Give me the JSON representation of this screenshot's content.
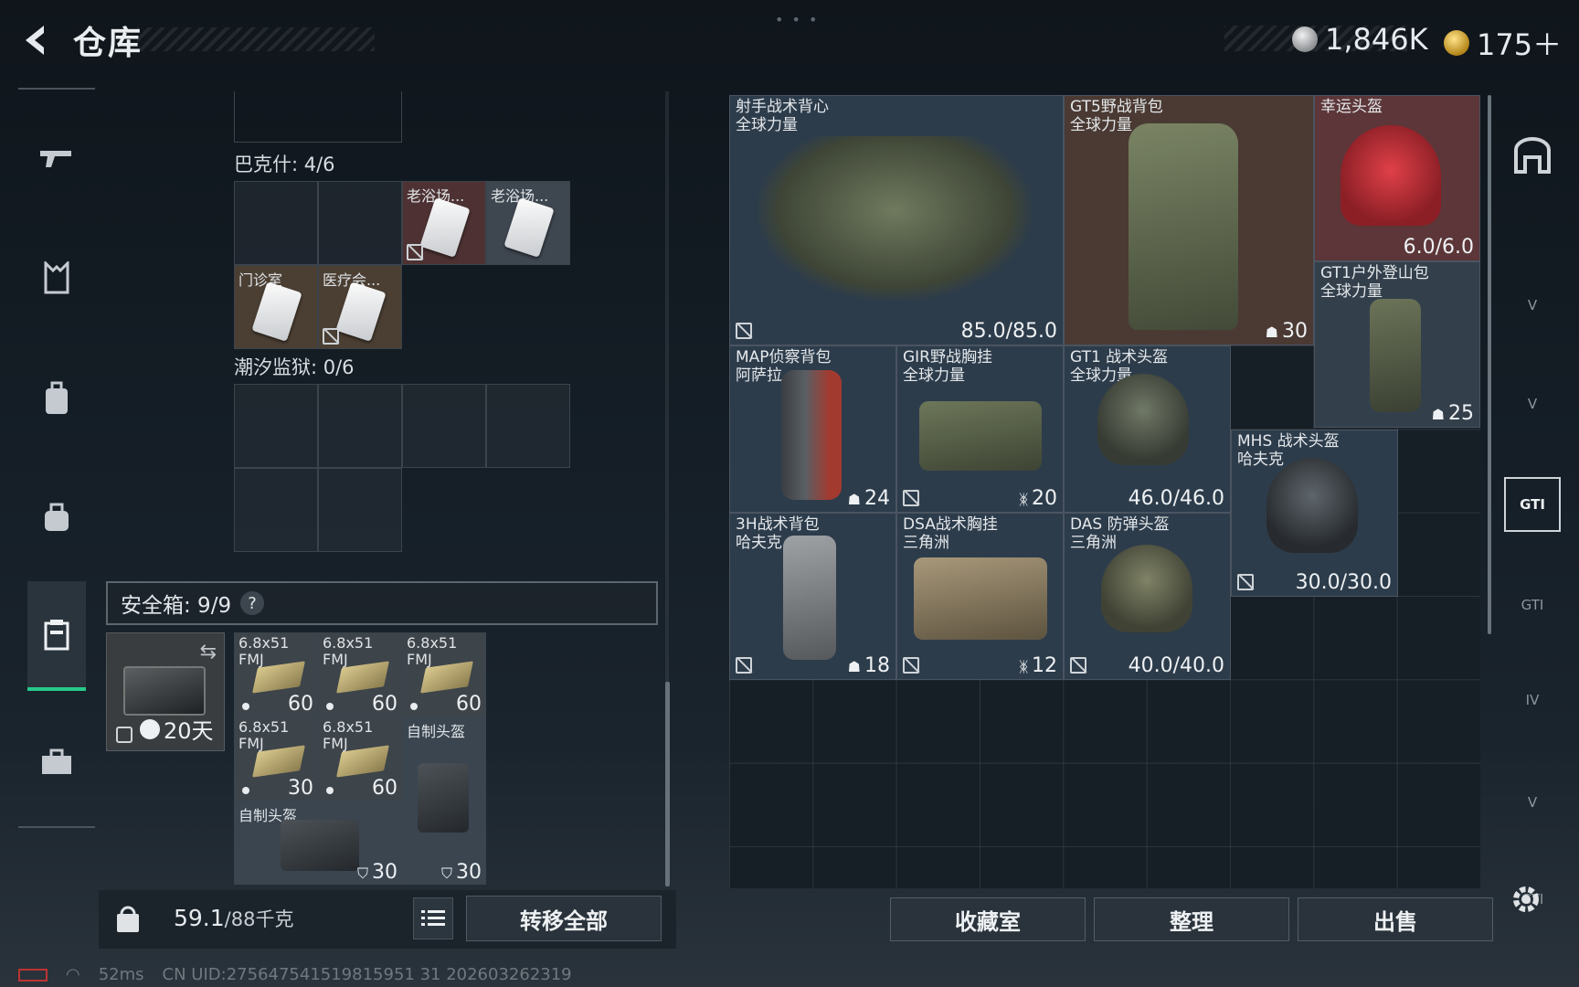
{
  "header": {
    "title": "仓库",
    "currency_silver": "1,846K",
    "currency_gold": "175＋"
  },
  "left_nav": [
    "weapon-icon",
    "vest-icon",
    "backpack-icon",
    "bag-icon",
    "safebox-icon",
    "toolbox-icon"
  ],
  "stash": {
    "section_bakshi": "巴克什: 4/6",
    "section_tidal": "潮汐监狱: 0/6",
    "keycards": [
      {
        "name": "老浴场..."
      },
      {
        "name": "老浴场..."
      },
      {
        "name": "门诊室"
      },
      {
        "name": "医疗会..."
      }
    ]
  },
  "safebox": {
    "header": "安全箱: 9/9",
    "help": "?",
    "timer": "20天",
    "items": [
      {
        "name": "6.8x51\nFMJ",
        "count": "60"
      },
      {
        "name": "6.8x51\nFMJ",
        "count": "60"
      },
      {
        "name": "6.8x51\nFMJ",
        "count": "60"
      },
      {
        "name": "6.8x51\nFMJ",
        "count": "30"
      },
      {
        "name": "6.8x51\nFMJ",
        "count": "60"
      },
      {
        "name": "自制头盔",
        "count": "30"
      },
      {
        "name": "自制头盔",
        "count": "30"
      }
    ]
  },
  "bottom_left": {
    "weight_value": "59.1",
    "weight_max": "/88千克",
    "transfer_all": "转移全部"
  },
  "stash_items": [
    {
      "name": "射手战术背心\n全球力量",
      "value": "85.0/85.0"
    },
    {
      "name": "GT5野战背包\n全球力量",
      "value": "30"
    },
    {
      "name": "幸运头盔",
      "value": "6.0/6.0"
    },
    {
      "name": "GT1户外登山包\n全球力量",
      "value": "25"
    },
    {
      "name": "MAP侦察背包\n阿萨拉",
      "value": "24"
    },
    {
      "name": "GIR野战胸挂\n全球力量",
      "value": "20"
    },
    {
      "name": "GT1 战术头盔\n全球力量",
      "value": "46.0/46.0"
    },
    {
      "name": "MHS 战术头盔\n哈夫克",
      "value": "30.0/30.0"
    },
    {
      "name": "3H战术背包\n哈夫克",
      "value": "18"
    },
    {
      "name": "DSA战术胸挂\n三角洲",
      "value": "12"
    },
    {
      "name": "DAS 防弹头盔\n三角洲",
      "value": "40.0/40.0"
    }
  ],
  "bottom_buttons": {
    "collection": "收藏室",
    "sort": "整理",
    "sell": "出售"
  },
  "filters": [
    "armory-icon",
    "V",
    "V",
    "GTI",
    "GTI",
    "IV",
    "V",
    "GTI"
  ],
  "status": {
    "ping": "52ms",
    "uid": "CN UID:275647541519815951 31 202603262319"
  },
  "colors": {
    "accent_green": "#27c98a",
    "tile_red": "#5c3638",
    "tile_brown": "#4a3a33",
    "tile_blue": "#2d3c4b"
  }
}
